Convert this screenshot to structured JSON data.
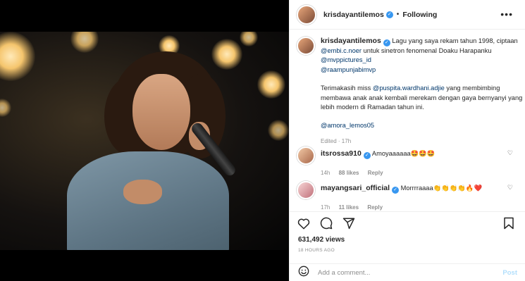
{
  "post": {
    "username": "krisdayantilemos",
    "separator": "•",
    "follow_status": "Following",
    "more_icon": "more-horizontal-icon"
  },
  "caption": {
    "line1": "Lagu yang saya rekam tahun 1998, ciptaan",
    "mention1": "@embi.c.noer",
    "line2": " untuk sinetron fenomenal Doaku Harapanku",
    "mention2": "@mvppictures_id",
    "mention3": "@raampunjabimvp",
    "para2_a": "Terimakasih miss ",
    "mention4": "@puspita.wardhani.adjie",
    "para2_b": " yang membimbing membawa anak anak kembali merekam dengan gaya bernyanyi yang lebih modern di Ramadan tahun ini.",
    "mention5": "@amora_lemos05",
    "edited": "Edited · 17h"
  },
  "comments": [
    {
      "username": "itsrossa910",
      "text": "Amoyaaaaaa🤩🤩🤩",
      "time": "14h",
      "likes": "88 likes",
      "reply": "Reply"
    },
    {
      "username": "mayangsari_official",
      "text": "Morrrraaaa👏👏👏👏🔥❤️",
      "time": "17h",
      "likes": "11 likes",
      "reply": "Reply"
    }
  ],
  "stats": {
    "likes": "631,492 views",
    "time_ago": "18 HOURS AGO"
  },
  "add_comment": {
    "placeholder": "Add a comment...",
    "post_label": "Post"
  },
  "colors": {
    "link": "#00376b",
    "verified": "#3897f0",
    "post_disabled": "#b2dffc"
  }
}
